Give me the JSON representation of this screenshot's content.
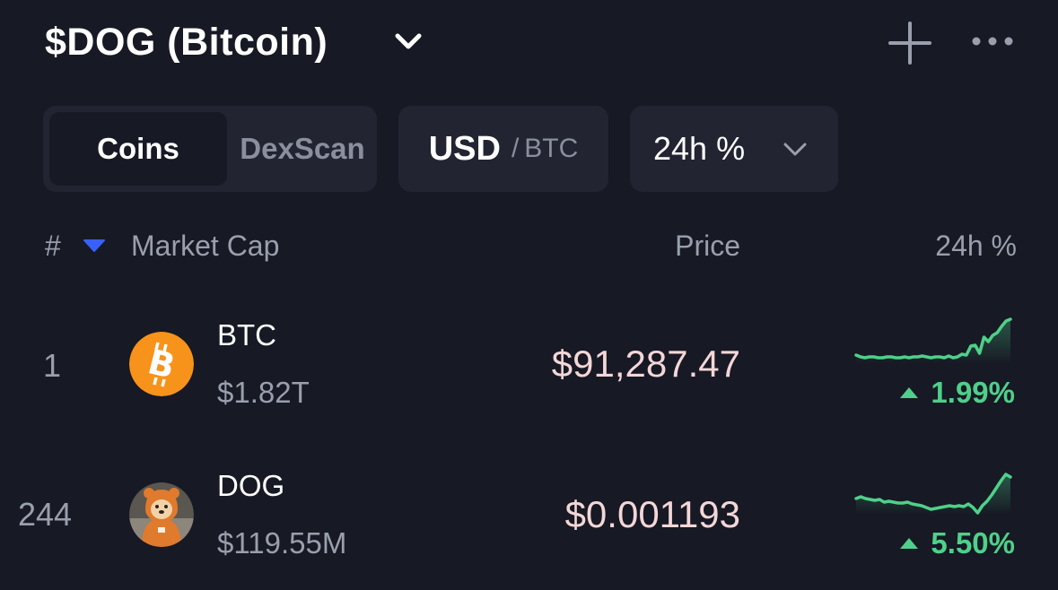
{
  "header": {
    "title": "$DOG (Bitcoin)"
  },
  "tabs": {
    "coins": "Coins",
    "dexscan": "DexScan"
  },
  "currency": {
    "primary": "USD",
    "separator": "/",
    "secondary": "BTC"
  },
  "period": {
    "label": "24h %"
  },
  "columns": {
    "rank": "#",
    "market_cap": "Market Cap",
    "price": "Price",
    "change": "24h %"
  },
  "rows": [
    {
      "rank": "1",
      "symbol": "BTC",
      "market_cap": "$1.82T",
      "price": "$91,287.47",
      "change": "1.99%",
      "sparkline": [
        50,
        52,
        53,
        52,
        52,
        53,
        53,
        52,
        52,
        53,
        53,
        52,
        53,
        52,
        52,
        51,
        52,
        53,
        52,
        52,
        53,
        51,
        53,
        52,
        49,
        50,
        40,
        39,
        48,
        30,
        35,
        28,
        25,
        18,
        12,
        10
      ],
      "trend": "up"
    },
    {
      "rank": "244",
      "symbol": "DOG",
      "market_cap": "$119.55M",
      "price": "$0.001193",
      "change": "5.50%",
      "sparkline": [
        42,
        40,
        42,
        43,
        44,
        43,
        46,
        45,
        46,
        47,
        47,
        46,
        48,
        49,
        50,
        52,
        54,
        53,
        52,
        51,
        50,
        51,
        50,
        51,
        48,
        52,
        58,
        50,
        45,
        38,
        30,
        22,
        15,
        18
      ],
      "trend": "up"
    }
  ],
  "colors": {
    "background": "#171924",
    "control_bg": "#222531",
    "positive": "#4fd08a",
    "sort_arrow": "#3861fb",
    "btc_orange": "#f7931a",
    "dog_orange": "#e07a2c"
  },
  "icons": {
    "title_chevron": "chevron-down-icon",
    "add": "plus-icon",
    "more": "more-horizontal-icon",
    "period_chevron": "chevron-down-icon",
    "sort": "sort-down-icon",
    "btc": "bitcoin-logo-icon",
    "dog": "dog-avatar-icon"
  }
}
